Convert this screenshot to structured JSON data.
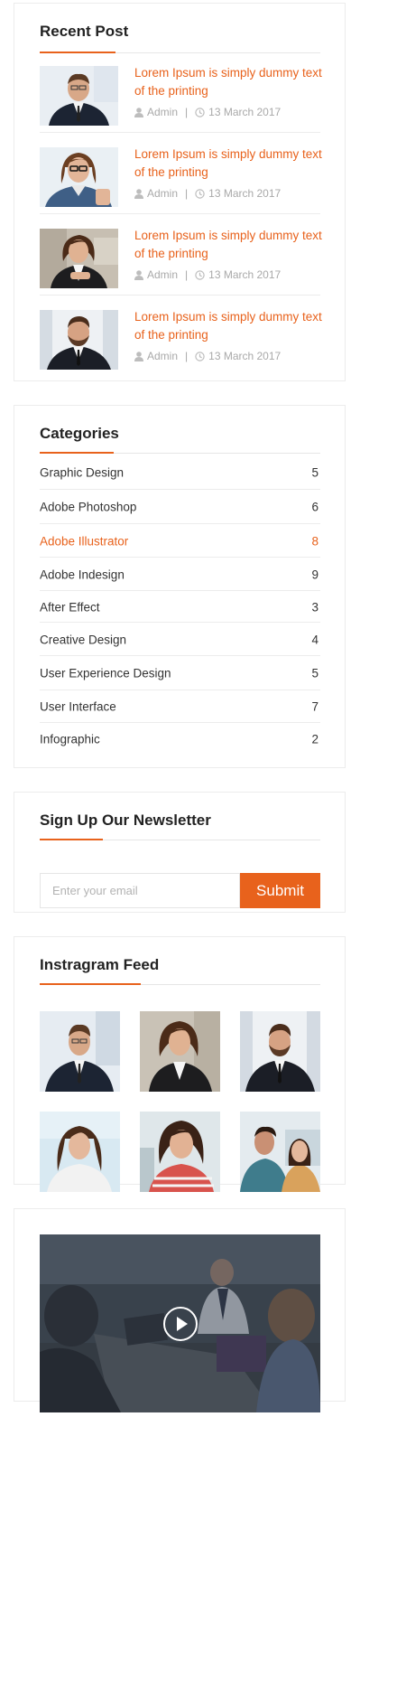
{
  "theme": {
    "accent": "#e8621c",
    "text": "#333333",
    "muted": "#a9a9a9"
  },
  "recent_posts": {
    "title": "Recent Post",
    "posts": [
      {
        "title": "Lorem Ipsum is simply dummy text of the printing",
        "author": "Admin",
        "date": "13 March 2017",
        "user_icon": "user-icon",
        "clock_icon": "clock-icon"
      },
      {
        "title": "Lorem Ipsum is simply dummy text of the printing",
        "author": "Admin",
        "date": "13 March 2017",
        "user_icon": "user-icon",
        "clock_icon": "clock-icon"
      },
      {
        "title": "Lorem Ipsum is simply dummy text of the printing",
        "author": "Admin",
        "date": "13 March 2017",
        "user_icon": "user-icon",
        "clock_icon": "clock-icon"
      },
      {
        "title": "Lorem Ipsum is simply dummy text of the printing",
        "author": "Admin",
        "date": "13 March 2017",
        "user_icon": "user-icon",
        "clock_icon": "clock-icon"
      }
    ],
    "separator": "|"
  },
  "categories": {
    "title": "Categories",
    "items": [
      {
        "label": "Graphic Design",
        "count": "5"
      },
      {
        "label": "Adobe Photoshop",
        "count": "6"
      },
      {
        "label": "Adobe Illustrator",
        "count": "8",
        "active": true
      },
      {
        "label": "Adobe Indesign",
        "count": "9"
      },
      {
        "label": "After Effect",
        "count": "3"
      },
      {
        "label": "Creative Design",
        "count": "4"
      },
      {
        "label": "User Experience Design",
        "count": "5"
      },
      {
        "label": "User Interface",
        "count": "7"
      },
      {
        "label": "Infographic",
        "count": "2"
      }
    ]
  },
  "newsletter": {
    "title": "Sign Up Our Newsletter",
    "email_placeholder": "Enter your email",
    "email_value": "",
    "submit_label": "Submit"
  },
  "instagram": {
    "title": "Instragram Feed",
    "photo_count": 6
  },
  "video": {
    "play_icon": "play-icon"
  }
}
